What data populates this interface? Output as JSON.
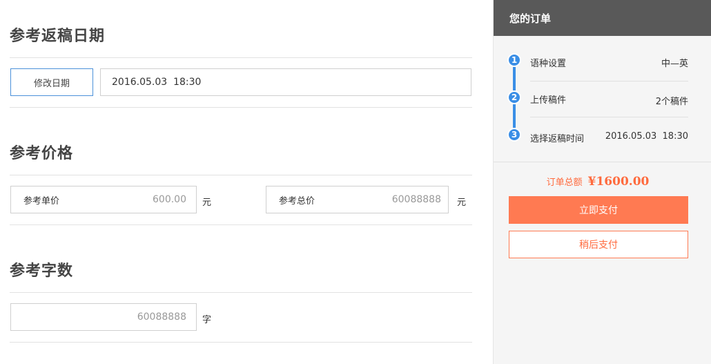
{
  "return_date": {
    "title": "参考返稿日期",
    "modify_button": "修改日期",
    "date_value": "2016.05.03  18:30"
  },
  "price": {
    "title": "参考价格",
    "unit_price_label": "参考单价",
    "unit_price_value": "600.00",
    "unit_price_unit": "元",
    "total_price_label": "参考总价",
    "total_price_value": "60088888",
    "total_price_unit": "元"
  },
  "word_count": {
    "title": "参考字数",
    "value": "60088888",
    "unit": "字"
  },
  "order": {
    "header": "您的订单",
    "steps": [
      {
        "number": "1",
        "label": "语种设置",
        "value": "中—英"
      },
      {
        "number": "2",
        "label": "上传稿件",
        "value": "2个稿件"
      },
      {
        "number": "3",
        "label": "选择返稿时间",
        "value": "2016.05.03  18:30"
      }
    ],
    "total_label": "订单总额",
    "total_amount": "¥1600.00",
    "pay_now": "立即支付",
    "pay_later": "稍后支付"
  },
  "colors": {
    "accent_blue": "#3a8ee6",
    "accent_orange": "#ff7a52",
    "sidebar_header": "#595959"
  }
}
